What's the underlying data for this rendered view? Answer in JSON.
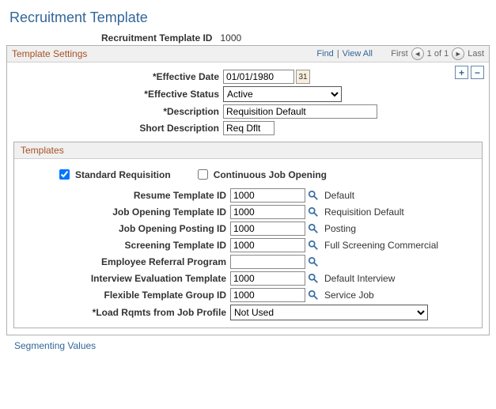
{
  "page_title": "Recruitment Template",
  "id_row": {
    "label": "Recruitment Template ID",
    "value": "1000"
  },
  "section": {
    "title": "Template Settings",
    "nav": {
      "find": "Find",
      "view_all": "View All",
      "first": "First",
      "pos": "1 of 1",
      "last": "Last"
    },
    "tools": {
      "add": "+",
      "remove": "−"
    },
    "effective_date": {
      "label": "Effective Date",
      "value": "01/01/1980"
    },
    "effective_status": {
      "label": "Effective Status",
      "value": "Active"
    },
    "description": {
      "label": "Description",
      "value": "Requisition Default"
    },
    "short_description": {
      "label": "Short Description",
      "value": "Req Dflt"
    }
  },
  "templates": {
    "title": "Templates",
    "standard_req": {
      "label": "Standard Requisition",
      "checked": true
    },
    "continuous": {
      "label": "Continuous Job Opening",
      "checked": false
    },
    "resume": {
      "label": "Resume Template ID",
      "value": "1000",
      "desc": "Default"
    },
    "job_opening": {
      "label": "Job Opening Template ID",
      "value": "1000",
      "desc": "Requisition Default"
    },
    "posting": {
      "label": "Job Opening Posting ID",
      "value": "1000",
      "desc": "Posting"
    },
    "screening": {
      "label": "Screening Template ID",
      "value": "1000",
      "desc": "Full Screening Commercial"
    },
    "referral": {
      "label": "Employee Referral Program",
      "value": "",
      "desc": ""
    },
    "interview": {
      "label": "Interview Evaluation Template",
      "value": "1000",
      "desc": "Default Interview"
    },
    "flex": {
      "label": "Flexible Template Group ID",
      "value": "1000",
      "desc": "Service Job"
    },
    "load": {
      "label": "Load Rqmts from Job Profile",
      "value": "Not Used"
    }
  },
  "segmenting_link": "Segmenting Values"
}
